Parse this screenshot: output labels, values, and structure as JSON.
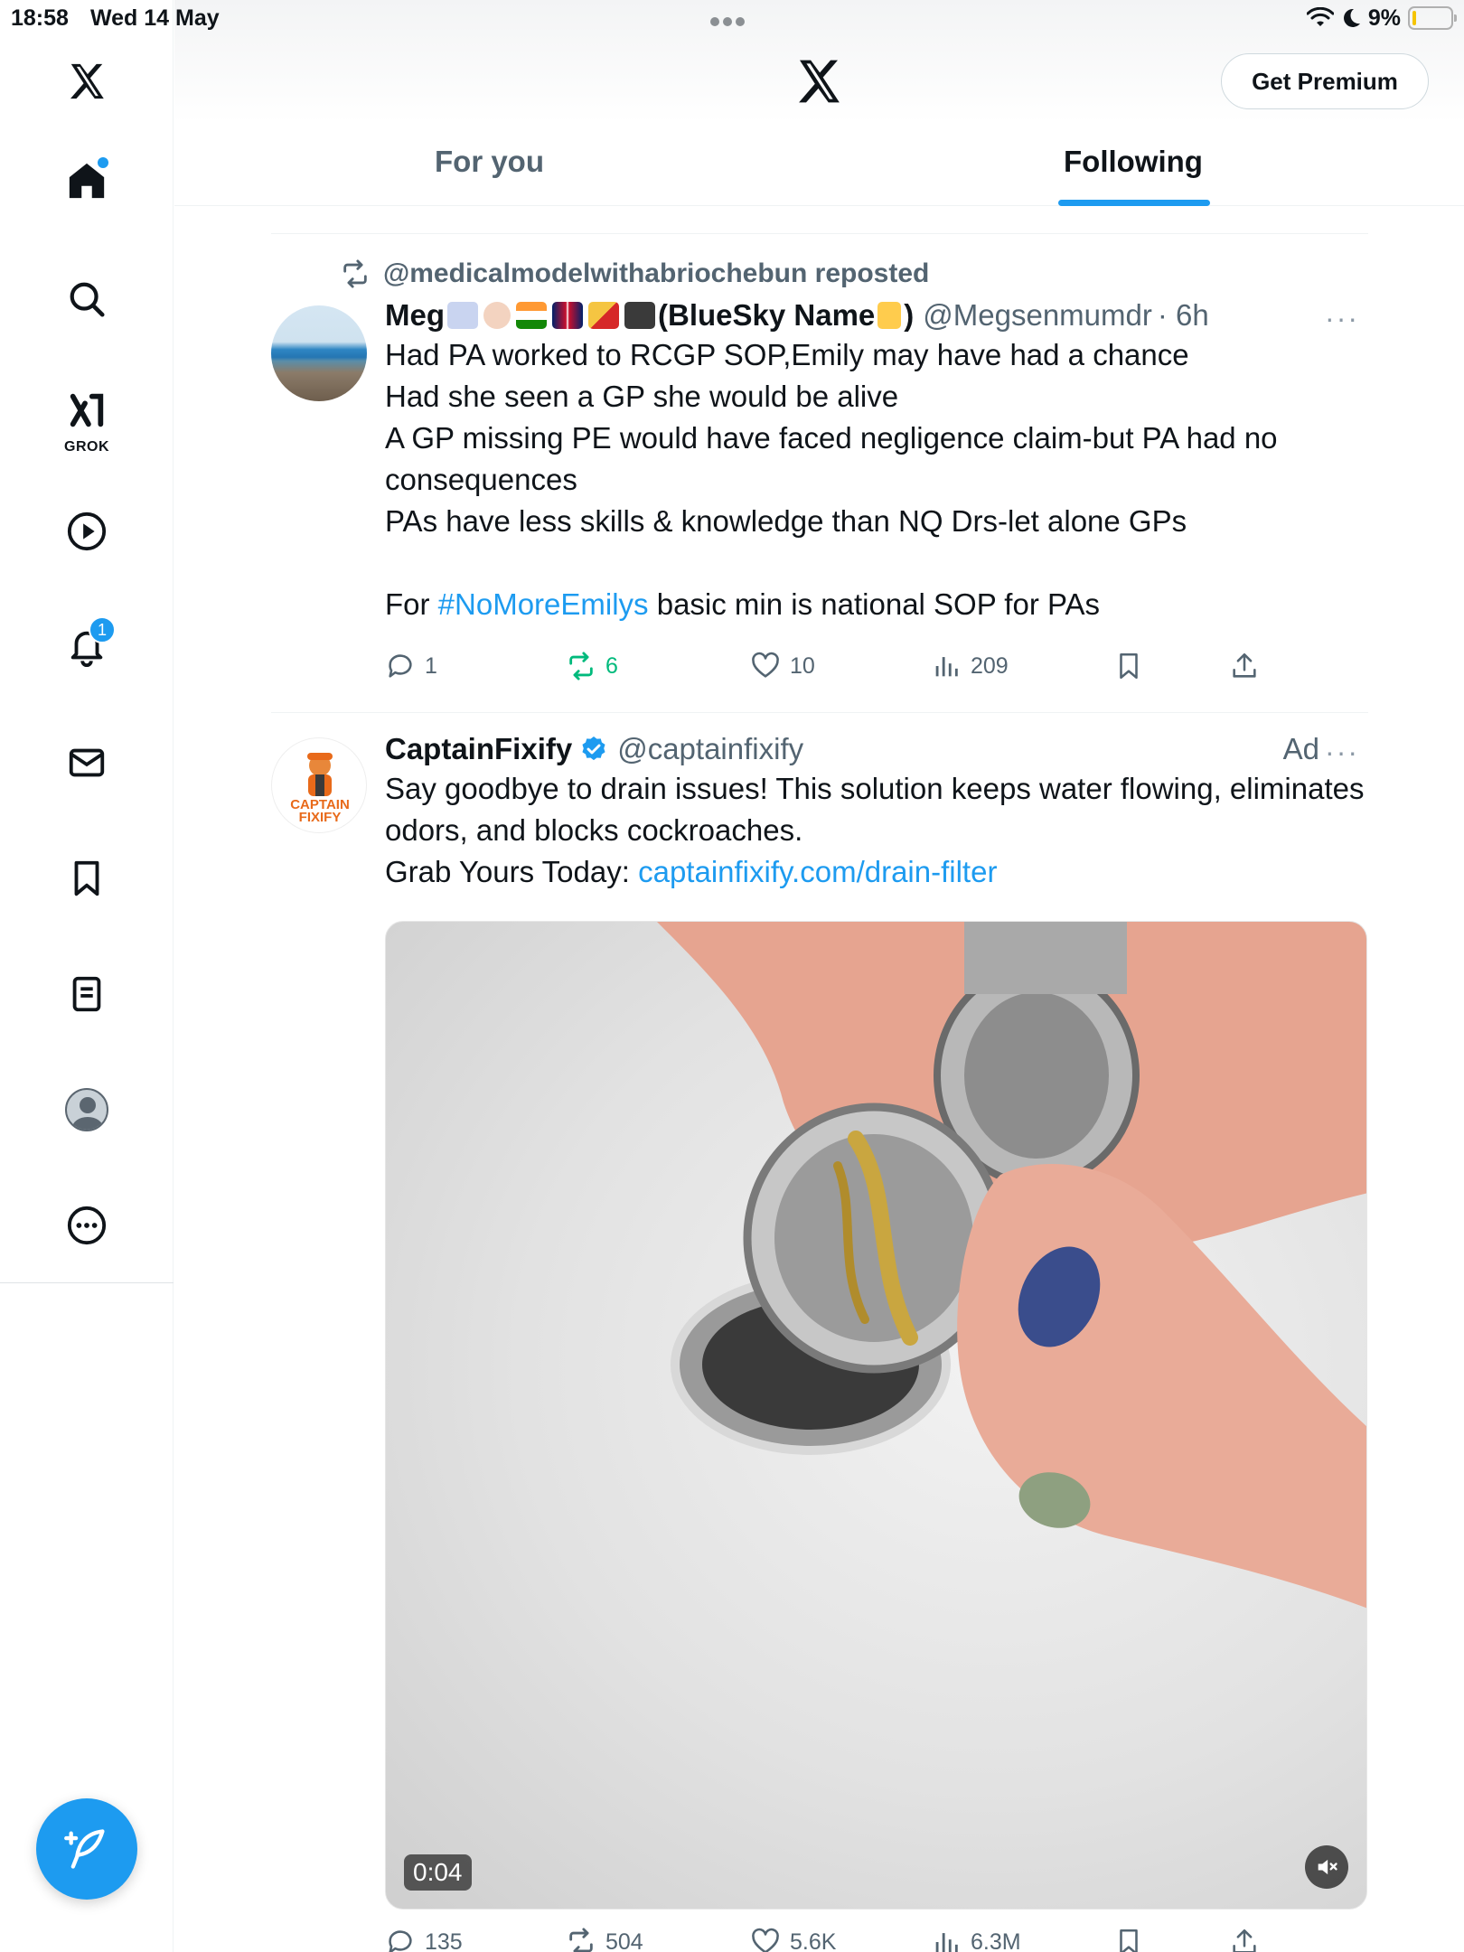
{
  "status_bar": {
    "time": "18:58",
    "date": "Wed 14 May",
    "battery": "9%",
    "battery_level": 0.09
  },
  "nav": {
    "items": [
      "home-icon",
      "search-icon",
      "grok-icon",
      "video-icon",
      "notifications-icon",
      "messages-icon",
      "bookmarks-icon",
      "lists-icon",
      "profile-icon",
      "more-icon"
    ],
    "grok_label": "GROK",
    "notifications_badge": "1"
  },
  "header": {
    "premium_button": "Get Premium",
    "tabs": [
      {
        "label": "For you",
        "active": false
      },
      {
        "label": "Following",
        "active": true
      }
    ]
  },
  "tweets": [
    {
      "repost_by": "@medicalmodelwithabriochebun reposted",
      "name_prefix": "Meg",
      "name_suffix": "(BlueSky Name",
      "name_close": ")",
      "handle": "@Megsenmumdr",
      "time": "· 6h",
      "text": "Had PA worked to RCGP SOP,Emily may have had a chance\nHad she seen a GP she would be alive\nA GP missing PE would have faced negligence claim-but PA had no consequences\nPAs have less skills & knowledge than NQ Drs-let alone GPs\n\nFor ",
      "hashtag": "#NoMoreEmilys",
      "text_after": " basic min is national SOP for PAs",
      "counts": {
        "replies": "1",
        "reposts": "6",
        "likes": "10",
        "views": "209"
      }
    },
    {
      "name": "CaptainFixify",
      "handle": "@captainfixify",
      "ad_label": "Ad",
      "avatar_text_1": "CAPTAIN",
      "avatar_text_2": "FIXIFY",
      "text": "Say goodbye to drain issues! This solution keeps water flowing, eliminates odors, and blocks cockroaches.\nGrab Yours Today: ",
      "link": "captainfixify.com/drain-filter",
      "video_time": "0:04",
      "counts": {
        "replies": "135",
        "reposts": "504",
        "likes": "5.6K",
        "views": "6.3M"
      }
    }
  ],
  "colors": {
    "accent": "#1d9bf0",
    "repost_green": "#00ba7c",
    "secondary_text": "#536471"
  }
}
